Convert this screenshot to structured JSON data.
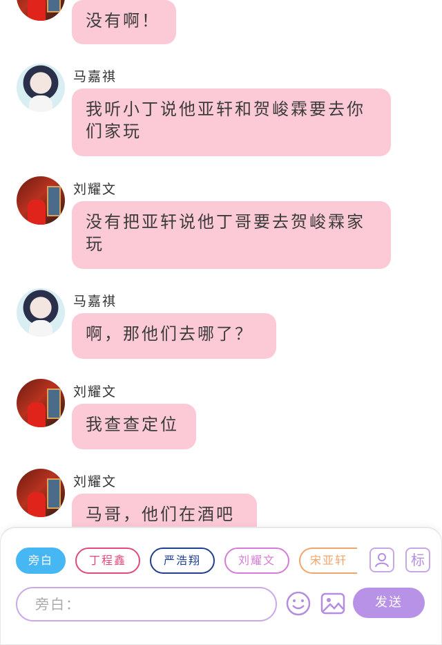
{
  "messages": [
    {
      "sender": "",
      "avatar": "liu",
      "text": "没有啊！"
    },
    {
      "sender": "马嘉祺",
      "avatar": "ma",
      "text": "我听小丁说他亚轩和贺峻霖要去你们家玩"
    },
    {
      "sender": "刘耀文",
      "avatar": "liu",
      "text": "没有把亚轩说他丁哥要去贺峻霖家玩"
    },
    {
      "sender": "马嘉祺",
      "avatar": "ma",
      "text": "啊，那他们去哪了？"
    },
    {
      "sender": "刘耀文",
      "avatar": "liu",
      "text": "我查查定位"
    },
    {
      "sender": "刘耀文",
      "avatar": "liu",
      "text": "马哥，他们在酒吧"
    }
  ],
  "composer": {
    "chips": [
      {
        "label": "旁白",
        "color": "#46b7f2",
        "active": true
      },
      {
        "label": "丁程鑫",
        "color": "#e0497a",
        "active": false
      },
      {
        "label": "严浩翔",
        "color": "#1f3f8c",
        "active": false
      },
      {
        "label": "刘耀文",
        "color": "#d77ad6",
        "active": false
      },
      {
        "label": "宋亚轩",
        "color": "#f0a46a",
        "active": false
      }
    ],
    "tag_icon_label": "标",
    "input_placeholder": "旁白：",
    "send_label": "发送"
  }
}
